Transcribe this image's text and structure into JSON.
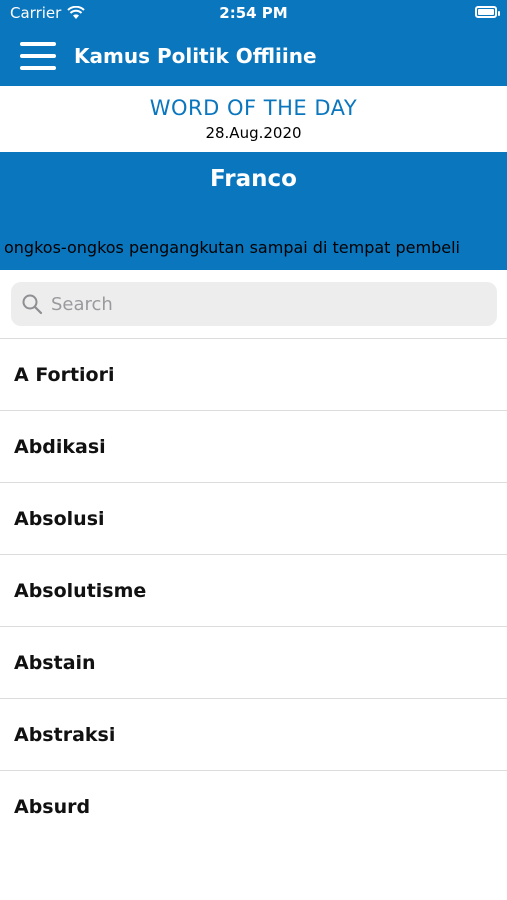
{
  "status_bar": {
    "carrier": "Carrier",
    "time": "2:54 PM"
  },
  "nav": {
    "title": "Kamus Politik Offliine"
  },
  "word_of_the_day": {
    "heading": "WORD OF THE DAY",
    "date": "28.Aug.2020",
    "word": "Franco",
    "definition": "ongkos-ongkos pengangkutan sampai di tempat pembeli"
  },
  "search": {
    "placeholder": "Search"
  },
  "words": [
    "A Fortiori",
    "Abdikasi",
    "Absolusi",
    "Absolutisme",
    "Abstain",
    "Abstraksi",
    "Absurd"
  ],
  "colors": {
    "primary": "#0a76be",
    "search_bg": "#ededed"
  }
}
